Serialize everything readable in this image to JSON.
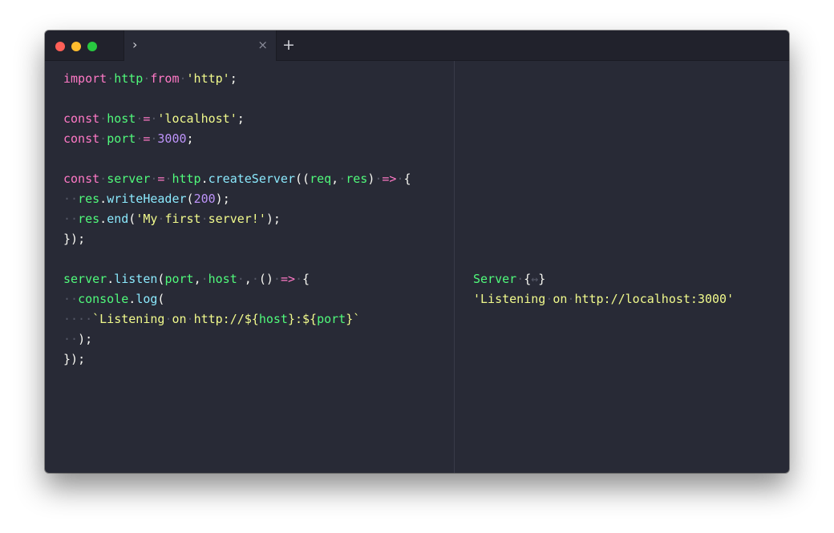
{
  "window": {
    "tab": {
      "prompt_symbol": "›",
      "close_symbol": "×"
    },
    "new_tab_symbol": "+"
  },
  "editor": {
    "lines": [
      "import http from 'http';",
      "",
      "const host = 'localhost';",
      "const port = 3000;",
      "",
      "const server = http.createServer((req, res) => {",
      "  res.writeHeader(200);",
      "  res.end('My first server!');",
      "});",
      "",
      "server.listen(port, host , () => {",
      "  console.log(",
      "    `Listening on http://${host}:${port}`",
      "  );",
      "});"
    ]
  },
  "output": {
    "lines": [
      "Server {↔}",
      "'Listening on http://localhost:3000'"
    ]
  },
  "colors": {
    "background": "#282a36",
    "keyword": "#ff79c6",
    "identifier": "#50fa7b",
    "string": "#f1fa8c",
    "number": "#bd93f9",
    "method": "#8be9fd",
    "whitespace_dot": "#545766"
  }
}
